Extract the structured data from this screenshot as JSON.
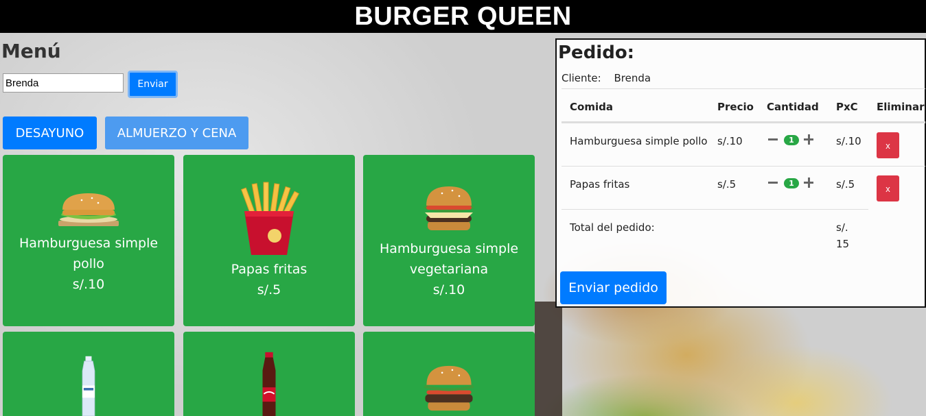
{
  "header": {
    "title": "BURGER QUEEN"
  },
  "menu": {
    "title": "Menú",
    "client_input_value": "Brenda",
    "send_label": "Enviar",
    "categories": [
      "DESAYUNO",
      "ALMUERZO Y CENA"
    ],
    "items": [
      {
        "name": "Hamburguesa simple pollo",
        "price": "s/.10",
        "image": "chicken-burger-image"
      },
      {
        "name": "Papas fritas",
        "price": "s/.5",
        "image": "french-fries-image"
      },
      {
        "name": "Hamburguesa simple vegetariana",
        "price": "s/.10",
        "image": "veggie-burger-image"
      },
      {
        "name": "",
        "price": "",
        "image": "water-bottle-image"
      },
      {
        "name": "",
        "price": "",
        "image": "cola-bottle-image"
      },
      {
        "name": "",
        "price": "",
        "image": "beef-burger-image"
      }
    ]
  },
  "order": {
    "title": "Pedido:",
    "client_label": "Cliente:",
    "client_name": "Brenda",
    "columns": [
      "Comida",
      "Precio",
      "Cantidad",
      "PxC",
      "Eliminar"
    ],
    "rows": [
      {
        "food": "Hamburguesa simple pollo",
        "price": "s/.10",
        "qty": "1",
        "pxc": "s/.10",
        "delete": "x"
      },
      {
        "food": "Papas fritas",
        "price": "s/.5",
        "qty": "1",
        "pxc": "s/.5",
        "delete": "x"
      }
    ],
    "total_label": "Total del pedido:",
    "total_value_line1": "s/.",
    "total_value_line2": "15",
    "send_label": "Enviar pedido"
  },
  "colors": {
    "primary": "#007bff",
    "success": "#28a745",
    "danger": "#dc3545",
    "header_bg": "#000000"
  }
}
